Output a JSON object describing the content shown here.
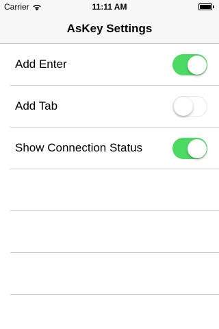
{
  "status_bar": {
    "carrier": "Carrier",
    "time": "11:11 AM",
    "wifi_icon": "wifi-icon",
    "battery_icon": "battery-icon",
    "battery_level": 1.0
  },
  "nav": {
    "title": "AsKey Settings"
  },
  "settings": [
    {
      "label": "Add Enter",
      "on": true
    },
    {
      "label": "Add Tab",
      "on": false
    },
    {
      "label": "Show Connection Status",
      "on": true
    }
  ],
  "colors": {
    "switch_on": "#4cd964",
    "separator": "#c8c7cc",
    "bar_background": "#f7f7f7"
  }
}
